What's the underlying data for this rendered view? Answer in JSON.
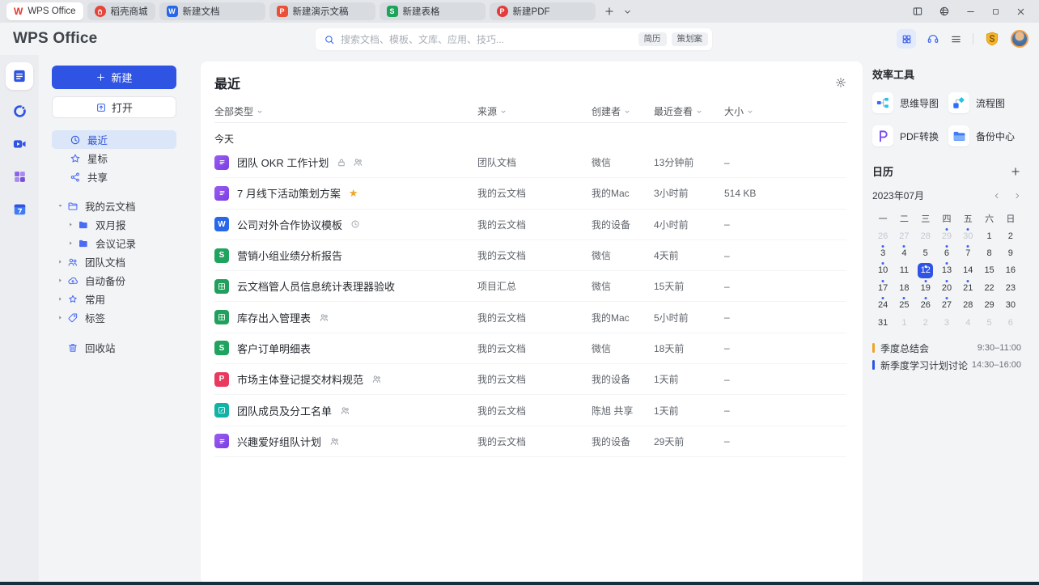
{
  "tab_bar": {
    "tabs": [
      {
        "label": "WPS Office",
        "icon": "wps-logo-icon",
        "active": true
      },
      {
        "label": "稻壳商城",
        "icon": "docer-icon"
      },
      {
        "label": "新建文档",
        "icon": "writer-icon",
        "wide": true
      },
      {
        "label": "新建演示文稿",
        "icon": "presentation-icon",
        "wide": true
      },
      {
        "label": "新建表格",
        "icon": "spreadsheet-icon",
        "wide": true
      },
      {
        "label": "新建PDF",
        "icon": "pdf-icon",
        "wide": true
      }
    ],
    "window_controls": [
      {
        "icon": "split-view-icon"
      },
      {
        "icon": "theme-icon"
      },
      {
        "icon": "minimize-icon"
      },
      {
        "icon": "maximize-icon"
      },
      {
        "icon": "close-icon"
      }
    ]
  },
  "header": {
    "logo_text": "WPS Office",
    "search": {
      "placeholder": "搜索文档、模板、文库、应用、技巧...",
      "tags": [
        "简历",
        "策划案"
      ]
    },
    "actions": [
      {
        "icon": "apps-grid-icon"
      },
      {
        "icon": "headset-icon"
      },
      {
        "icon": "menu-icon"
      },
      {
        "icon": "vip-badge-icon"
      },
      {
        "icon": "avatar"
      }
    ]
  },
  "rail": {
    "items": [
      {
        "name": "documents",
        "icon": "doc-icon",
        "active": true
      },
      {
        "name": "messages",
        "icon": "clock-ring-icon"
      },
      {
        "name": "meeting",
        "icon": "video-camera-icon"
      },
      {
        "name": "apps",
        "icon": "apps-purple-icon"
      },
      {
        "name": "calendar",
        "icon": "calendar-7-icon"
      }
    ]
  },
  "sidebar": {
    "new_button": "新建",
    "open_button": "打开",
    "nav": [
      {
        "label": "最近",
        "icon": "clock",
        "active": true
      },
      {
        "label": "星标",
        "icon": "star"
      },
      {
        "label": "共享",
        "icon": "share"
      }
    ],
    "tree": [
      {
        "label": "我的云文档",
        "icon": "folder-open",
        "caret": "down",
        "level": 0
      },
      {
        "label": "双月报",
        "icon": "folder-solid",
        "caret": "right",
        "level": 1
      },
      {
        "label": "会议记录",
        "icon": "folder-solid",
        "caret": "right",
        "level": 1
      },
      {
        "label": "团队文档",
        "icon": "team",
        "caret": "right",
        "level": 0
      },
      {
        "label": "自动备份",
        "icon": "cloud-backup",
        "caret": "right",
        "level": 0
      },
      {
        "label": "常用",
        "icon": "star-badge",
        "caret": "right",
        "level": 0
      },
      {
        "label": "标签",
        "icon": "tag",
        "caret": "right",
        "level": 0
      }
    ],
    "trash": {
      "label": "回收站",
      "icon": "trash"
    }
  },
  "main": {
    "title": "最近",
    "filters": [
      {
        "label": "全部类型"
      },
      {
        "label": "来源"
      },
      {
        "label": "创建者"
      },
      {
        "label": "最近查看"
      },
      {
        "label": "大小"
      }
    ],
    "section_label": "今天",
    "rows": [
      {
        "title": "团队 OKR 工作计划",
        "icon": "writer-purple-icon",
        "badges": [
          "lock",
          "members"
        ],
        "source": "团队文档",
        "creator": "微信",
        "viewed": "13分钟前",
        "size": "–"
      },
      {
        "title": "7 月线下活动策划方案",
        "icon": "writer-purple-icon",
        "badges": [
          "star"
        ],
        "source": "我的云文档",
        "creator": "我的Mac",
        "viewed": "3小时前",
        "size": "514 KB"
      },
      {
        "title": "公司对外合作协议模板",
        "icon": "writer-blue-icon",
        "badges": [
          "history"
        ],
        "source": "我的云文档",
        "creator": "我的设备",
        "viewed": "4小时前",
        "size": "–"
      },
      {
        "title": "营销小组业绩分析报告",
        "icon": "sheet-green-icon",
        "badges": [],
        "source": "我的云文档",
        "creator": "微信",
        "viewed": "4天前",
        "size": "–"
      },
      {
        "title": "云文档管人员信息统计表理器验收",
        "icon": "table-green-icon",
        "badges": [],
        "source": "项目汇总",
        "creator": "微信",
        "viewed": "15天前",
        "size": "–"
      },
      {
        "title": "库存出入管理表",
        "icon": "table-green-icon",
        "badges": [
          "members"
        ],
        "source": "我的云文档",
        "creator": "我的Mac",
        "viewed": "5小时前",
        "size": "–"
      },
      {
        "title": "客户订单明细表",
        "icon": "sheet-green-icon",
        "badges": [],
        "source": "我的云文档",
        "creator": "微信",
        "viewed": "18天前",
        "size": "–"
      },
      {
        "title": "市场主体登记提交材料规范",
        "icon": "pdf-pink-icon",
        "badges": [
          "members"
        ],
        "source": "我的云文档",
        "creator": "我的设备",
        "viewed": "1天前",
        "size": "–"
      },
      {
        "title": "团队成员及分工名单",
        "icon": "kdocs-teal-icon",
        "badges": [
          "members"
        ],
        "source": "我的云文档",
        "creator": "陈旭 共享",
        "viewed": "1天前",
        "size": "–"
      },
      {
        "title": "兴趣爱好组队计划",
        "icon": "writer-purple-icon",
        "badges": [
          "members"
        ],
        "source": "我的云文档",
        "creator": "我的设备",
        "viewed": "29天前",
        "size": "–"
      }
    ]
  },
  "tools": {
    "title": "效率工具",
    "items": [
      {
        "label": "思维导图",
        "icon": "mindmap-icon"
      },
      {
        "label": "流程图",
        "icon": "flowchart-icon"
      },
      {
        "label": "PDF转换",
        "icon": "pdf-convert-icon"
      },
      {
        "label": "备份中心",
        "icon": "backup-center-icon"
      }
    ]
  },
  "calendar": {
    "title": "日历",
    "month_label": "2023年07月",
    "weekdays": [
      "一",
      "二",
      "三",
      "四",
      "五",
      "六",
      "日"
    ],
    "days": [
      {
        "d": "26",
        "muted": 1
      },
      {
        "d": "27",
        "muted": 1
      },
      {
        "d": "28",
        "muted": 1
      },
      {
        "d": "29",
        "muted": 1,
        "dot": 1
      },
      {
        "d": "30",
        "muted": 1,
        "dot": 1
      },
      {
        "d": "1"
      },
      {
        "d": "2"
      },
      {
        "d": "3",
        "dot": 1
      },
      {
        "d": "4",
        "dot": 1
      },
      {
        "d": "5"
      },
      {
        "d": "6",
        "dot": 1
      },
      {
        "d": "7",
        "dot": 1
      },
      {
        "d": "8"
      },
      {
        "d": "9"
      },
      {
        "d": "10",
        "dot": 1
      },
      {
        "d": "11"
      },
      {
        "d": "12",
        "selected": 1,
        "dot": 1
      },
      {
        "d": "13",
        "dot": 1
      },
      {
        "d": "14"
      },
      {
        "d": "15"
      },
      {
        "d": "16"
      },
      {
        "d": "17",
        "dot": 1
      },
      {
        "d": "18"
      },
      {
        "d": "19",
        "dot": 1
      },
      {
        "d": "20",
        "dot": 1
      },
      {
        "d": "21",
        "dot": 1
      },
      {
        "d": "22"
      },
      {
        "d": "23"
      },
      {
        "d": "24",
        "dot": 1
      },
      {
        "d": "25",
        "dot": 1
      },
      {
        "d": "26",
        "dot": 1
      },
      {
        "d": "27",
        "dot": 1
      },
      {
        "d": "28"
      },
      {
        "d": "29"
      },
      {
        "d": "30"
      },
      {
        "d": "31"
      },
      {
        "d": "1",
        "muted": 1
      },
      {
        "d": "2",
        "muted": 1
      },
      {
        "d": "3",
        "muted": 1
      },
      {
        "d": "4",
        "muted": 1
      },
      {
        "d": "5",
        "muted": 1
      },
      {
        "d": "6",
        "muted": 1
      }
    ],
    "events": [
      {
        "label": "季度总结会",
        "time": "9:30–11:00",
        "color": "#f0a32a"
      },
      {
        "label": "新季度学习计划讨论",
        "time": "14:30–16:00",
        "color": "#2f54e4"
      }
    ]
  },
  "colors": {
    "accent": "#2f54e4",
    "tab_active_bg": "#ffffff",
    "selected_nav_bg": "#dbe6f8"
  }
}
